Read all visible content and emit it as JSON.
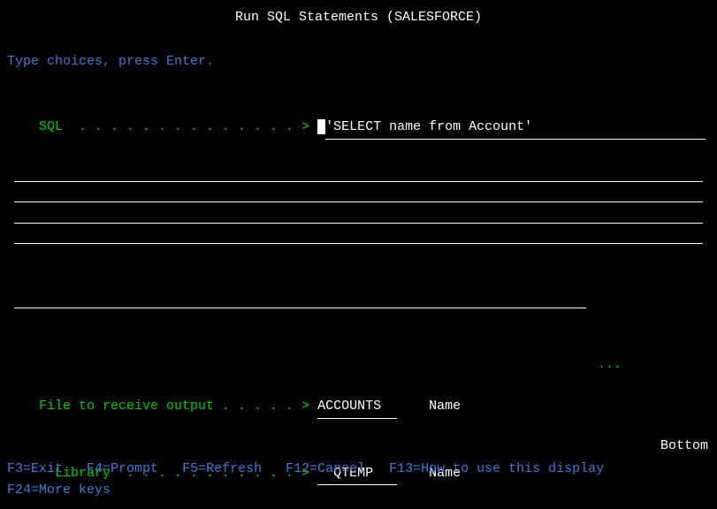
{
  "title": "Run SQL Statements (SALESFORCE)",
  "instruction": "Type choices, press Enter.",
  "fields": {
    "sql": {
      "label": "SQL  . . . . . . . . . . . . . . >",
      "value": "'SELECT name from Account'"
    },
    "cont_ellipsis": " ...",
    "file": {
      "label": "File to receive output . . . . . >",
      "value": "ACCOUNTS  ",
      "hint": "Name"
    },
    "library": {
      "label": "  Library  . . . . . . . . . . . >",
      "value": "  QTEMP   ",
      "hint": "Name"
    }
  },
  "bottom_label": "Bottom",
  "fkeys": [
    "F3=Exit",
    "F4=Prompt",
    "F5=Refresh",
    "F12=Cancel",
    "F13=How to use this display",
    "F24=More keys"
  ]
}
